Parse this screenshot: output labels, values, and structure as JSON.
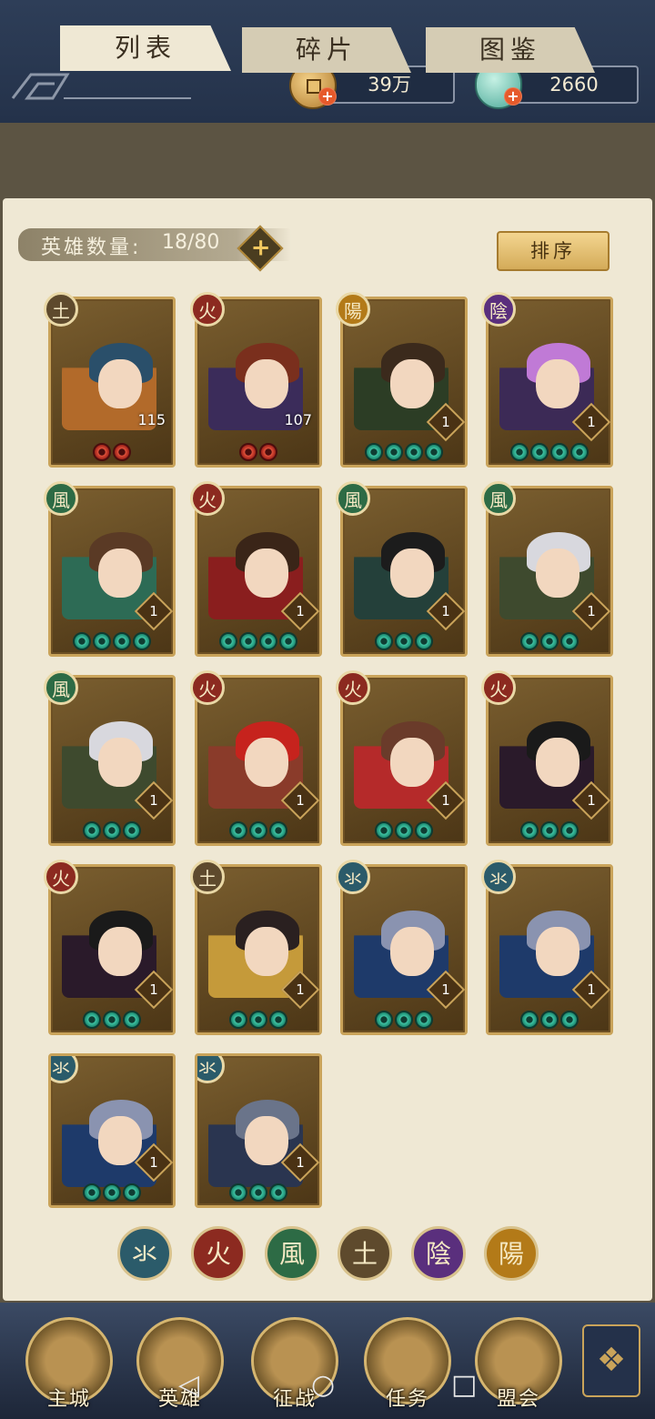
{
  "resources": {
    "coins": "39万",
    "jade": "2660"
  },
  "tabs": [
    "列表",
    "碎片",
    "图鉴"
  ],
  "hero_count": {
    "label": "英雄数量:",
    "value": "18/80"
  },
  "sort_label": "排序",
  "elements": {
    "water": "氺",
    "fire": "火",
    "wind": "風",
    "earth": "土",
    "yin": "陰",
    "yang": "陽"
  },
  "heroes": [
    {
      "element": "土",
      "level": "115",
      "rank": "",
      "stars": 2,
      "star_color": "red"
    },
    {
      "element": "火",
      "level": "107",
      "rank": "",
      "stars": 2,
      "star_color": "red"
    },
    {
      "element": "陽",
      "level": "",
      "rank": "1",
      "stars": 4,
      "star_color": "green"
    },
    {
      "element": "陰",
      "level": "",
      "rank": "1",
      "stars": 4,
      "star_color": "green"
    },
    {
      "element": "風",
      "level": "",
      "rank": "1",
      "stars": 4,
      "star_color": "green"
    },
    {
      "element": "火",
      "level": "",
      "rank": "1",
      "stars": 4,
      "star_color": "green"
    },
    {
      "element": "風",
      "level": "",
      "rank": "1",
      "stars": 3,
      "star_color": "green"
    },
    {
      "element": "風",
      "level": "",
      "rank": "1",
      "stars": 3,
      "star_color": "green"
    },
    {
      "element": "風",
      "level": "",
      "rank": "1",
      "stars": 3,
      "star_color": "green"
    },
    {
      "element": "火",
      "level": "",
      "rank": "1",
      "stars": 3,
      "star_color": "green"
    },
    {
      "element": "火",
      "level": "",
      "rank": "1",
      "stars": 3,
      "star_color": "green"
    },
    {
      "element": "火",
      "level": "",
      "rank": "1",
      "stars": 3,
      "star_color": "green"
    },
    {
      "element": "火",
      "level": "",
      "rank": "1",
      "stars": 3,
      "star_color": "green"
    },
    {
      "element": "土",
      "level": "",
      "rank": "1",
      "stars": 3,
      "star_color": "green"
    },
    {
      "element": "氺",
      "level": "",
      "rank": "1",
      "stars": 3,
      "star_color": "green"
    },
    {
      "element": "氺",
      "level": "",
      "rank": "1",
      "stars": 3,
      "star_color": "green"
    },
    {
      "element": "氺",
      "level": "",
      "rank": "1",
      "stars": 3,
      "star_color": "green"
    },
    {
      "element": "氺",
      "level": "",
      "rank": "1",
      "stars": 3,
      "star_color": "green"
    }
  ],
  "filters": [
    "氺",
    "火",
    "風",
    "土",
    "陰",
    "陽"
  ],
  "nav": [
    "主城",
    "英雄",
    "征战",
    "任务",
    "盟会"
  ],
  "colors": {
    "water": "#2b5b6a",
    "fire": "#8c2a20",
    "wind": "#2d6b45",
    "earth": "#5e4a2d",
    "yin": "#5a2f7d",
    "yang": "#b37a18",
    "gold": "#c9a35a"
  }
}
